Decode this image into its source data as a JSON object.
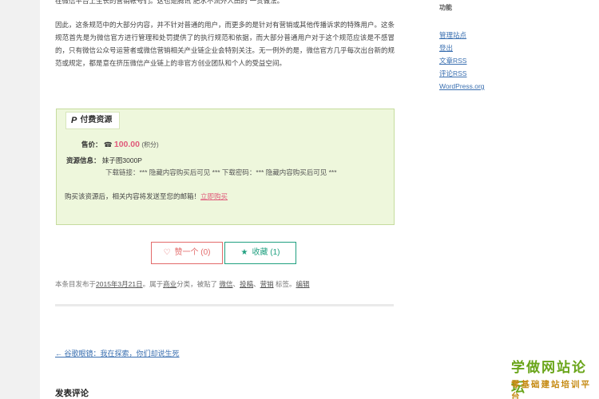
{
  "article": {
    "paragraph_top": "在微信平台上生长的营销帐号们。这也是腾讯“肥水不流外人田的”一贯做法。",
    "paragraph_2": "因此，这条规范中的大部分内容，并不针对普通的用户，而更多的是针对有营销或其他传播诉求的特殊用户。这条规范首先是为微信官方进行管理和处罚提供了的执行规范和依据，而大部分普通用户对于这个规范应该是不感冒的，只有微信公众号运营者或微信营销相关产业链企业会特别关注。无一例外的是，微信官方几乎每次出台新的规范或规定，都是意在挤压微信产业链上的非官方创业团队和个人的受益空间。"
  },
  "pay_box": {
    "icon": "P",
    "title": "付费资源",
    "price_label": "售价：",
    "price_icon": "☎",
    "price_value": "100.00",
    "price_unit": "(积分)",
    "resource_label": "资源信息：",
    "resource_value": "妹子图3000P",
    "download_text": "下载链接：*** 隐藏内容购买后可见 ***   下载密码：*** 隐藏内容购买后可见 ***",
    "buy_note": "购买该资源后，相关内容将发送至您的邮箱！",
    "buy_link": "立即购买"
  },
  "actions": {
    "like_icon": "♡",
    "like_label": "赞一个 (0)",
    "fav_icon": "★",
    "fav_label": "收藏 (1)"
  },
  "meta": {
    "prefix": "本条目发布于",
    "date": "2015年3月21日",
    "category_text": "。属于",
    "category": "商业",
    "tags_text": "分类，被贴了",
    "tag1": "微信",
    "tag_sep1": "、",
    "tag2": "投稿",
    "tag_sep2": "、",
    "tag3": "营销",
    "suffix": "标签。",
    "edit": "编辑"
  },
  "nav": {
    "prev": "← 谷歌眼镜：我在探索，你们却说生死"
  },
  "comments": {
    "heading": "发表评论"
  },
  "sidebar": {
    "title": "功能",
    "links": [
      "管理站点",
      "登出",
      "文章RSS",
      "评论RSS",
      "WordPress.org"
    ]
  },
  "watermark": {
    "line1": "学做网站论坛",
    "line2": "零基础建站培训平台"
  }
}
